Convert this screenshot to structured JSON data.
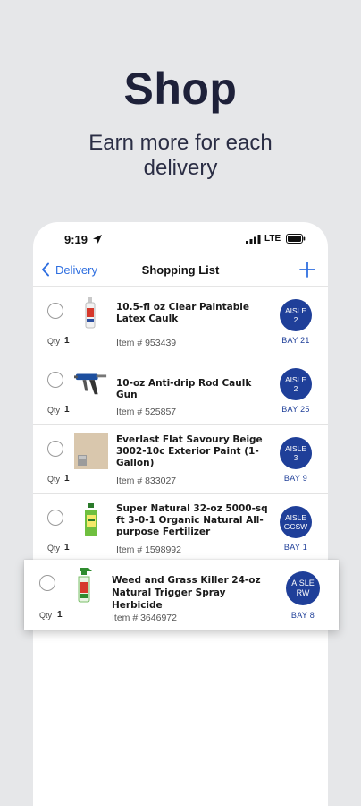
{
  "promo": {
    "headline": "Shop",
    "subline": "Earn more for each delivery"
  },
  "status_bar": {
    "time": "9:19",
    "network": "LTE",
    "icons": [
      "location-arrow-icon",
      "signal-icon",
      "battery-icon"
    ]
  },
  "nav": {
    "back_label": "Delivery",
    "title": "Shopping List",
    "add_icon": "plus-icon"
  },
  "qty_label": "Qty",
  "items": [
    {
      "name": "10.5-fl oz Clear Paintable Latex Caulk",
      "item_no": "Item # 953439",
      "qty": "1",
      "aisle_label": "AISLE",
      "aisle_value": "2",
      "bay": "BAY 21",
      "thumb": "caulk-tube-icon"
    },
    {
      "name": "10-oz Anti-drip Rod Caulk Gun",
      "item_no": "Item # 525857",
      "qty": "1",
      "aisle_label": "AISLE",
      "aisle_value": "2",
      "bay": "BAY 25",
      "thumb": "caulk-gun-icon"
    },
    {
      "name": "Everlast Flat Savoury Beige 3002-10c Exterior Paint (1-Gallon)",
      "item_no": "Item # 833027",
      "qty": "1",
      "aisle_label": "AISLE",
      "aisle_value": "3",
      "bay": "BAY 9",
      "thumb": "paint-swatch-icon"
    },
    {
      "name": "Super Natural 32-oz 5000-sq ft 3-0-1 Organic Natural All-purpose Fertilizer",
      "item_no": "Item # 1598992",
      "qty": "1",
      "aisle_label": "AISLE",
      "aisle_value": "GCSW",
      "bay": "BAY 1",
      "thumb": "fertilizer-jug-icon"
    }
  ],
  "highlighted_item": {
    "name": "Weed and Grass Killer 24-oz Natural Trigger Spray Herbicide",
    "item_no": "Item # 3646972",
    "qty": "1",
    "aisle_label": "AISLE",
    "aisle_value": "RW",
    "bay": "BAY 8",
    "thumb": "spray-bottle-icon"
  },
  "colors": {
    "background": "#e6e7e9",
    "accent": "#1f3f99",
    "link": "#2f6fe0",
    "headline": "#1e2139"
  }
}
